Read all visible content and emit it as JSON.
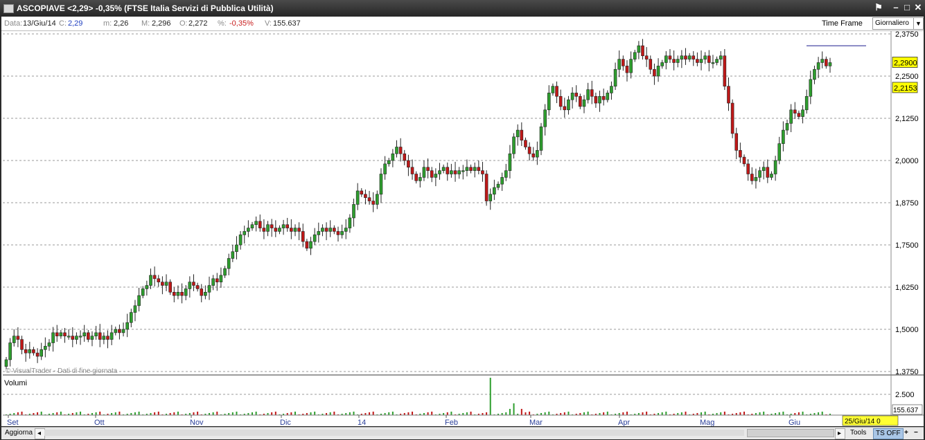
{
  "window": {
    "title": "ASCOPIAVE <2,29> -0,35%  (FTSE Italia Servizi di Pubblica Utilità)"
  },
  "infobar": {
    "data_label": "Data:",
    "data_value": "13/Giu/14",
    "c_label": "C:",
    "c_value": "2,29",
    "m_label": "m:",
    "m_value": "2,26",
    "M_label": "M:",
    "M_value": "2,296",
    "o_label": "O:",
    "o_value": "2,272",
    "pct_label": "%:",
    "pct_value": "-0,35%",
    "v_label": "V:",
    "v_value": "155.637",
    "time_frame_label": "Time Frame",
    "time_frame_value": "Giornaliero"
  },
  "colors": {
    "up": "#2e9e2e",
    "down": "#c01818",
    "level_line": "#1a1a8c",
    "price_tag_bg": "#ffff00",
    "date_tag_bg": "#ffff33",
    "grid": "#9a9a9a"
  },
  "chart_data": [
    {
      "type": "candlestick",
      "yaxis_ticks": [
        "2,3750",
        "2,2500",
        "2,1250",
        "2,0000",
        "1,8750",
        "1,7500",
        "1,6250",
        "1,5000",
        "1,3750"
      ],
      "ylim": [
        1.375,
        2.375
      ],
      "x_ticks": [
        "Set",
        "Ott",
        "Nov",
        "Dic",
        "14",
        "Feb",
        "Mar",
        "Apr",
        "Mag",
        "Giu"
      ],
      "price_tags": [
        "2,2900",
        "2,2153"
      ],
      "horizontal_levels": [
        2.4,
        2.34
      ],
      "watermark": "© VisualTrader - Dati di fine giornata",
      "closes": [
        1.41,
        1.46,
        1.48,
        1.47,
        1.44,
        1.43,
        1.44,
        1.43,
        1.42,
        1.44,
        1.45,
        1.46,
        1.49,
        1.48,
        1.49,
        1.48,
        1.48,
        1.47,
        1.48,
        1.48,
        1.49,
        1.47,
        1.48,
        1.49,
        1.47,
        1.48,
        1.47,
        1.49,
        1.5,
        1.49,
        1.5,
        1.52,
        1.55,
        1.57,
        1.6,
        1.62,
        1.63,
        1.66,
        1.65,
        1.64,
        1.63,
        1.64,
        1.61,
        1.6,
        1.61,
        1.6,
        1.62,
        1.64,
        1.63,
        1.62,
        1.6,
        1.61,
        1.63,
        1.65,
        1.64,
        1.66,
        1.68,
        1.71,
        1.73,
        1.75,
        1.78,
        1.79,
        1.8,
        1.81,
        1.82,
        1.8,
        1.79,
        1.81,
        1.8,
        1.79,
        1.8,
        1.81,
        1.8,
        1.79,
        1.8,
        1.79,
        1.76,
        1.74,
        1.76,
        1.78,
        1.79,
        1.8,
        1.79,
        1.8,
        1.79,
        1.78,
        1.79,
        1.8,
        1.83,
        1.87,
        1.91,
        1.9,
        1.89,
        1.88,
        1.87,
        1.9,
        1.96,
        1.99,
        2.0,
        2.02,
        2.04,
        2.02,
        2.0,
        1.98,
        1.96,
        1.94,
        1.95,
        1.98,
        1.97,
        1.95,
        1.96,
        1.97,
        1.98,
        1.96,
        1.97,
        1.96,
        1.97,
        1.97,
        1.98,
        1.97,
        1.98,
        1.97,
        1.96,
        1.88,
        1.9,
        1.92,
        1.93,
        1.95,
        1.97,
        2.02,
        2.07,
        2.09,
        2.06,
        2.04,
        2.02,
        2.01,
        2.03,
        2.1,
        2.15,
        2.2,
        2.22,
        2.19,
        2.16,
        2.15,
        2.18,
        2.2,
        2.19,
        2.16,
        2.18,
        2.21,
        2.19,
        2.17,
        2.19,
        2.18,
        2.2,
        2.22,
        2.27,
        2.3,
        2.28,
        2.26,
        2.3,
        2.32,
        2.34,
        2.31,
        2.3,
        2.27,
        2.25,
        2.28,
        2.29,
        2.31,
        2.3,
        2.29,
        2.3,
        2.31,
        2.3,
        2.31,
        2.3,
        2.29,
        2.3,
        2.31,
        2.29,
        2.29,
        2.3,
        2.31,
        2.22,
        2.17,
        2.08,
        2.03,
        2.01,
        1.99,
        1.96,
        1.94,
        1.95,
        1.97,
        1.98,
        1.95,
        1.96,
        2.0,
        2.05,
        2.09,
        2.11,
        2.15,
        2.14,
        2.13,
        2.15,
        2.19,
        2.24,
        2.27,
        2.29,
        2.3,
        2.28,
        2.29
      ]
    },
    {
      "type": "bar",
      "title": "Volumi",
      "yaxis_ticks": [
        "2.500"
      ],
      "last_value_tag": "155.637",
      "date_tag": "25/Giu/14 0"
    }
  ],
  "statusbar": {
    "refresh_label": "Aggiorna",
    "tools_label": "Tools",
    "ts_label": "TS OFF",
    "zoom_in": "+",
    "zoom_out": "−"
  }
}
